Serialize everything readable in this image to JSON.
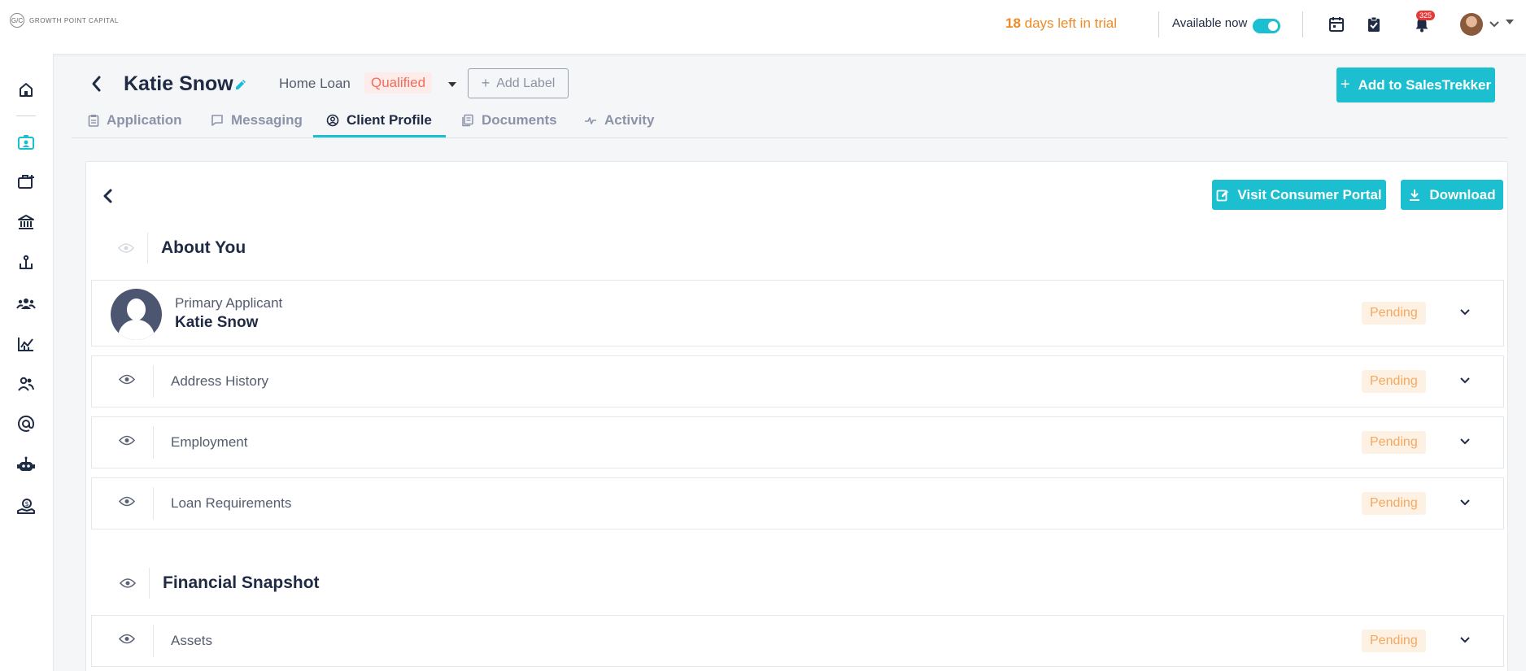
{
  "brand": {
    "logo_mark": "G/C",
    "logo_text": "GROWTH POINT CAPITAL"
  },
  "topbar": {
    "trial_days": "18",
    "trial_text": " days left in trial",
    "available_label": "Available now",
    "available_on": true,
    "notification_count": "325",
    "icons": [
      "calendar-icon",
      "tasks-icon",
      "bell-icon",
      "user-avatar",
      "chevron-down-icon"
    ]
  },
  "sidebar": {
    "items": [
      "home-icon",
      "client-card-icon",
      "briefcase-plus-icon",
      "bank-icon",
      "anchor-icon",
      "team-icon",
      "chart-icon",
      "users-icon",
      "at-icon",
      "robot-icon",
      "money-hand-icon"
    ],
    "active": "client-card-icon"
  },
  "header": {
    "client_name": "Katie Snow",
    "loan_type": "Home Loan",
    "status": "Qualified",
    "add_label": "Add Label",
    "add_salestrekker": "Add to SalesTrekker"
  },
  "tabs": [
    {
      "label": "Application",
      "icon": "clipboard-icon"
    },
    {
      "label": "Messaging",
      "icon": "message-icon"
    },
    {
      "label": "Client Profile",
      "icon": "user-circle-icon",
      "active": true
    },
    {
      "label": "Documents",
      "icon": "documents-icon"
    },
    {
      "label": "Activity",
      "icon": "activity-icon"
    }
  ],
  "panel": {
    "visit_portal": "Visit Consumer Portal",
    "download": "Download",
    "section_about": "About You",
    "primary": {
      "role": "Primary Applicant",
      "name": "Katie Snow",
      "status": "Pending"
    },
    "rows": [
      {
        "label": "Address History",
        "status": "Pending"
      },
      {
        "label": "Employment",
        "status": "Pending"
      },
      {
        "label": "Loan Requirements",
        "status": "Pending"
      }
    ],
    "section_financial": "Financial Snapshot",
    "assets": {
      "label": "Assets",
      "status": "Pending"
    }
  },
  "colors": {
    "accent": "#1bbfcf",
    "navy": "#1f2a44",
    "trial": "#f08a24",
    "qualified": "#f26d5b",
    "pending_text": "#f4a860",
    "pending_bg": "#fdf1e4"
  }
}
